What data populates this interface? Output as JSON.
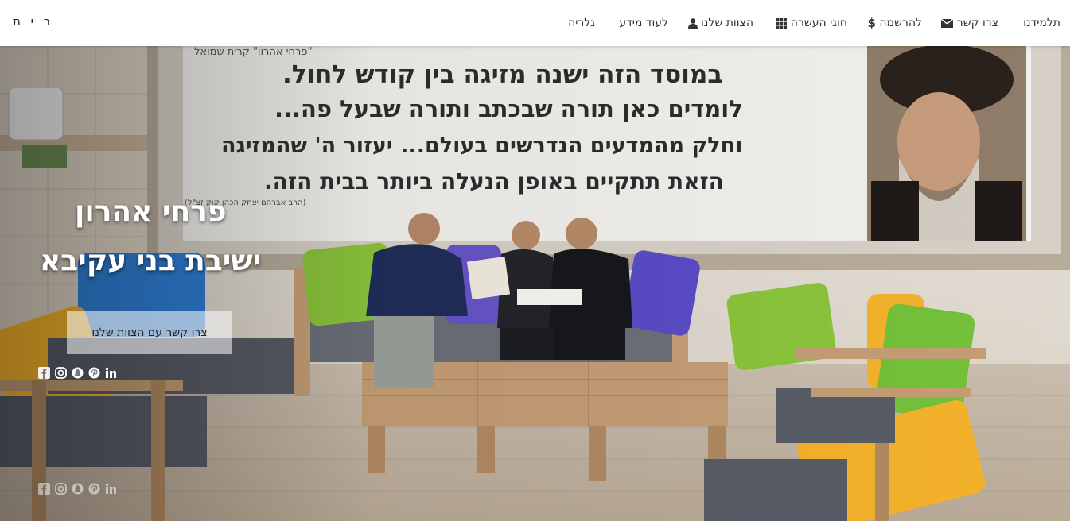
{
  "navbar": {
    "brand": "ב י ת",
    "items": [
      {
        "label": "תלמידנו",
        "icon": ""
      },
      {
        "label": "צרו קשר",
        "icon": "envelope-icon"
      },
      {
        "label": "להרשמה",
        "icon": "dollar-icon"
      },
      {
        "label": "חוגי העשרה",
        "icon": "grid-icon"
      },
      {
        "label": "הצוות שלנו",
        "icon": "user-icon"
      },
      {
        "label": "לעוד מידע",
        "icon": ""
      },
      {
        "label": "גלריה",
        "icon": ""
      }
    ]
  },
  "banner": {
    "header_small": "\"פרחי אהרון\" קרית שמואל",
    "lines": [
      "במוסד הזה ישנה מזיגה בין קודש לחול.",
      "לומדים כאן תורה שבכתב ותורה שבעל פה...",
      "וחלק מהמדעים הנדרשים בעולם... יעזור ה' שהמזיגה",
      "הזאת תתקיים באופן הנעלה ביותר בבית הזה."
    ],
    "signature": "(הרב אברהם יצחק הכהן קוק זצ\"ל)"
  },
  "hero": {
    "title_line1": "פרחי אהרון",
    "title_line2": "ישיבת בני עקיבא",
    "cta_label": "צרו קשר עם הצוות שלנו"
  },
  "social": [
    "facebook-icon",
    "instagram-icon",
    "snapchat-icon",
    "pinterest-icon",
    "linkedin-icon"
  ],
  "colors": {
    "nav_bg": "#ffffff",
    "hero_text": "#ffffff",
    "cta_bg": "rgba(255,255,255,0.55)"
  }
}
